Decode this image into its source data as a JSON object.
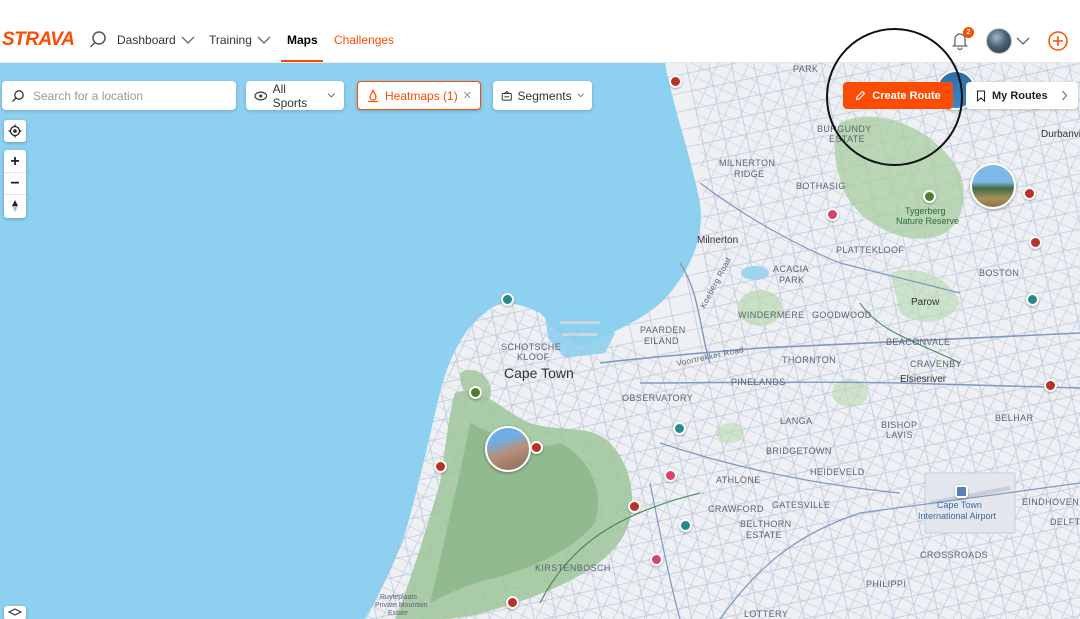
{
  "nav": {
    "logo": "STRAVA",
    "items": {
      "dashboard": "Dashboard",
      "training": "Training",
      "maps": "Maps",
      "challenges": "Challenges"
    },
    "notification_count": "2",
    "icons": [
      "search-icon",
      "bell-icon",
      "avatar",
      "plus-circle-icon"
    ]
  },
  "search": {
    "placeholder": "Search for a location"
  },
  "filters": {
    "sports": "All Sports",
    "heatmaps": "Heatmaps (1)",
    "segments": "Segments"
  },
  "actions": {
    "create_route": "Create Route",
    "my_routes": "My Routes"
  },
  "map": {
    "labels": {
      "park": "PARK",
      "burgundy": "BURGUNDY",
      "estate": "ESTATE",
      "durbanville": "Durbanvi",
      "milnerton_ridge_1": "MILNERTON",
      "milnerton_ridge_2": "RIDGE",
      "bothasig": "BOTHASIG",
      "tygerberg_1": "Tygerberg",
      "tygerberg_2": "Nature Reserve",
      "milnerton": "Milnerton",
      "plattekloof": "PLATTEKLOOF",
      "acacia_1": "ACACIA",
      "acacia_2": "PARK",
      "boston": "BOSTON",
      "koeberg": "Koeberg Road",
      "parow": "Parow",
      "paarden_1": "PAARDEN",
      "paarden_2": "EILAND",
      "windermere": "WINDERMERE",
      "goodwood": "GOODWOOD",
      "beaconvale": "BEACONVALE",
      "voortrekker": "Voortrekker Road",
      "schotsche_1": "SCHOTSCHE",
      "schotsche_2": "KLOOF",
      "thornton": "THORNTON",
      "cravenby": "CRAVENBY",
      "cape_town": "Cape Town",
      "pinelands": "PINELANDS",
      "elsiesriver": "Elsiesriver",
      "observatory": "OBSERVATORY",
      "belhar": "BELHAR",
      "langa": "LANGA",
      "bishop_1": "BISHOP",
      "bishop_2": "LAVIS",
      "bridgetown": "BRIDGETOWN",
      "heideveld": "HEIDEVELD",
      "athlone": "ATHLONE",
      "airport_1": "Cape Town",
      "airport_2": "International Airport",
      "eindhoven": "EINDHOVEN",
      "crawford": "CRAWFORD",
      "gatesville": "GATESVILLE",
      "belthorn_1": "BELTHORN",
      "belthorn_2": "ESTATE",
      "delft": "DELFT",
      "crossroads": "CROSSROADS",
      "philippi": "PHILIPPI",
      "kirstenbosch": "KIRSTENBOSCH",
      "ruyteplaats_1": "Ruyteplaats",
      "ruyteplaats_2": "Private Mountain",
      "ruyteplaats_3": "Estate",
      "lotus": "LOTTERY"
    }
  },
  "colors": {
    "brand": "#fc4c02",
    "ocean": "#8dd0ef",
    "land": "#eef0f3",
    "mountain": "#9fc59a"
  }
}
